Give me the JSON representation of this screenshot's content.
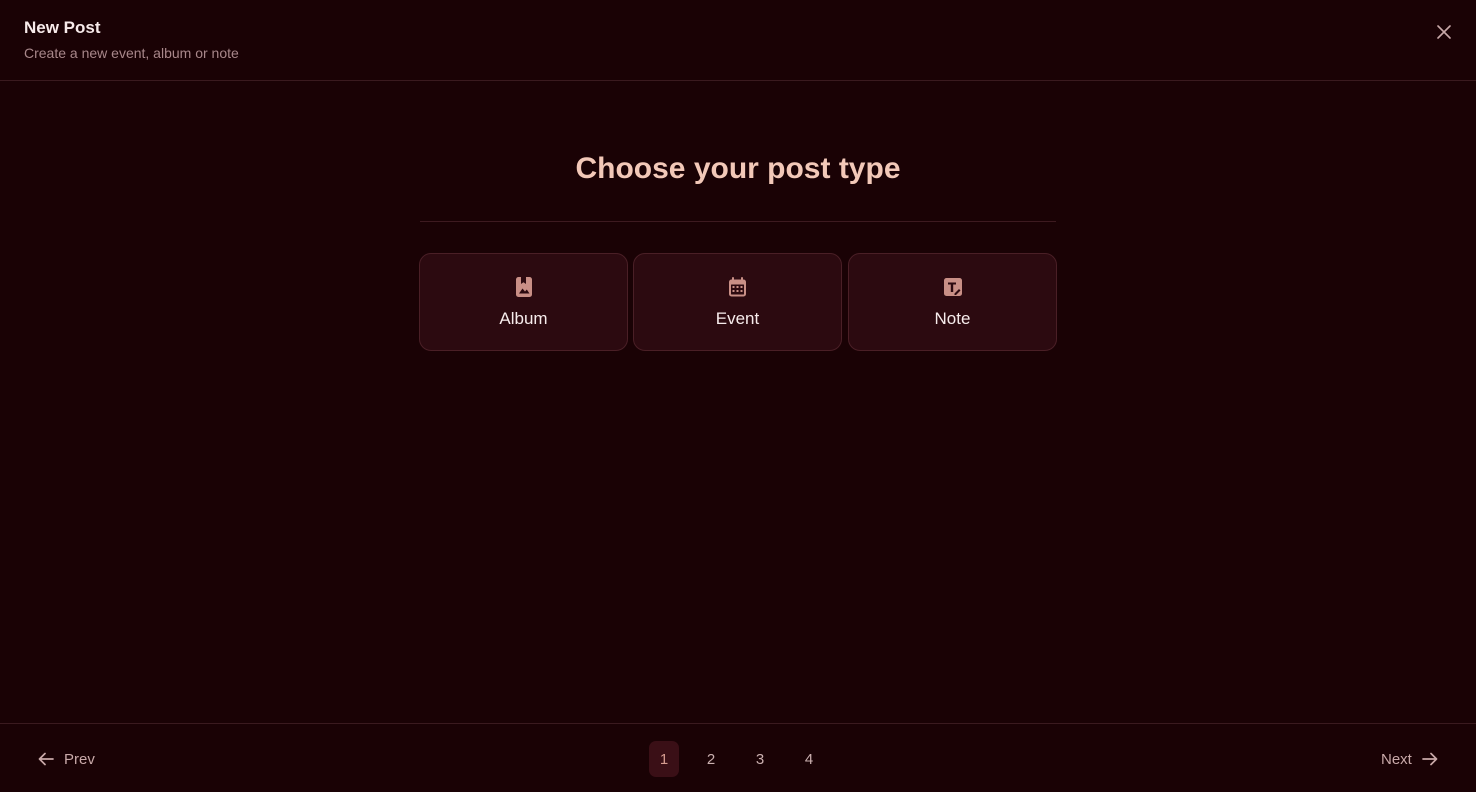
{
  "header": {
    "title": "New Post",
    "subtitle": "Create a new event, album or note"
  },
  "main": {
    "heading": "Choose your post type",
    "types": [
      {
        "label": "Album",
        "icon": "album-bookmark-icon"
      },
      {
        "label": "Event",
        "icon": "calendar-icon"
      },
      {
        "label": "Note",
        "icon": "note-edit-icon"
      }
    ]
  },
  "footer": {
    "prev_label": "Prev",
    "next_label": "Next",
    "pages": [
      "1",
      "2",
      "3",
      "4"
    ],
    "active_page": "1"
  },
  "colors": {
    "background": "#1a0205",
    "card": "#2c0a10",
    "accent": "#f2c8b8",
    "icon": "#c98f86"
  }
}
